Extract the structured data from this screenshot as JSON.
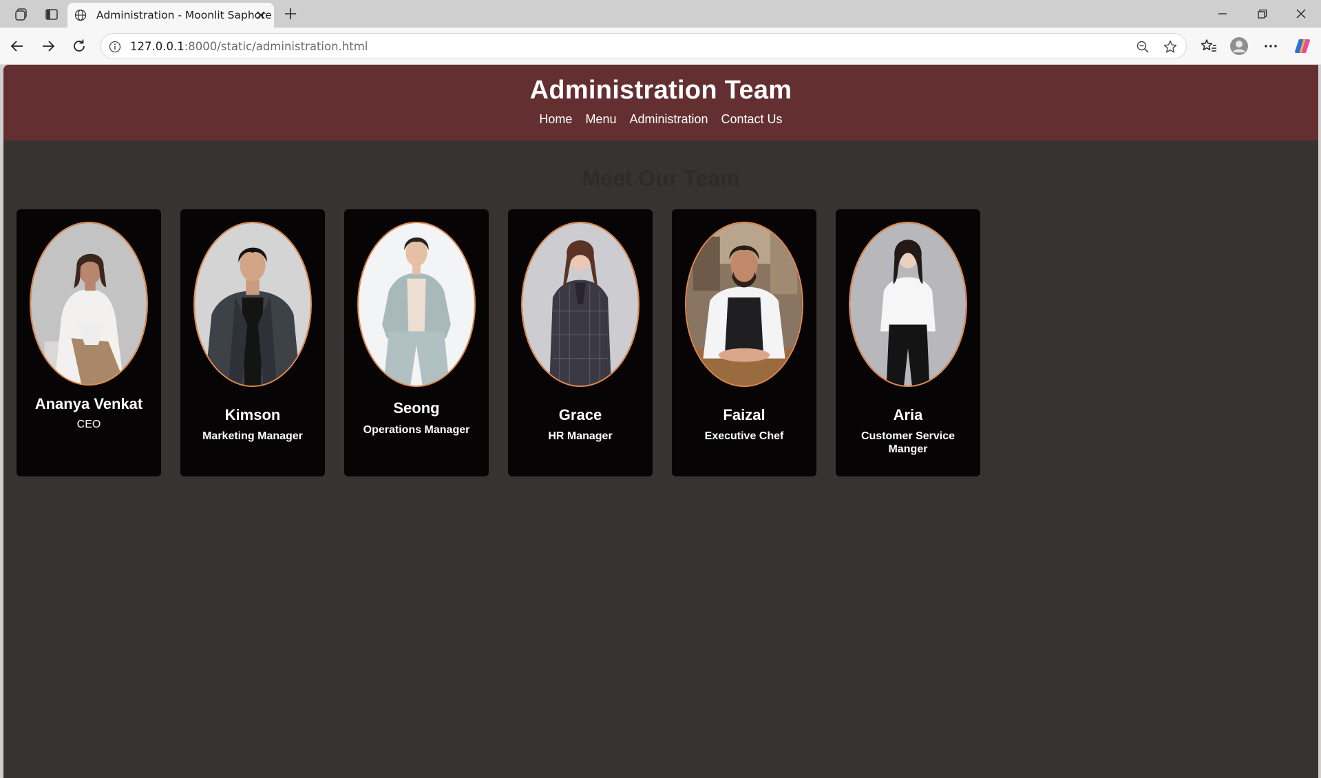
{
  "browser": {
    "tab_title": "Administration - Moonlit Saphore",
    "url_host": "127.0.0.1",
    "url_rest": ":8000/static/administration.html"
  },
  "site": {
    "title": "Administration Team",
    "nav": [
      "Home",
      "Menu",
      "Administration",
      "Contact Us"
    ]
  },
  "section": {
    "title": "Meet Our Team"
  },
  "team": [
    {
      "name": "Ananya Venkat",
      "role": "CEO"
    },
    {
      "name": "Kimson",
      "role": "Marketing Manager"
    },
    {
      "name": "Seong",
      "role": "Operations Manager"
    },
    {
      "name": "Grace",
      "role": "HR Manager"
    },
    {
      "name": "Faizal",
      "role": "Executive Chef"
    },
    {
      "name": "Aria",
      "role": "Customer Service Manger"
    }
  ],
  "colors": {
    "header": "#642f30",
    "page_bg": "#383333",
    "card_bg": "#060404",
    "photo_border": "#e3884a"
  }
}
